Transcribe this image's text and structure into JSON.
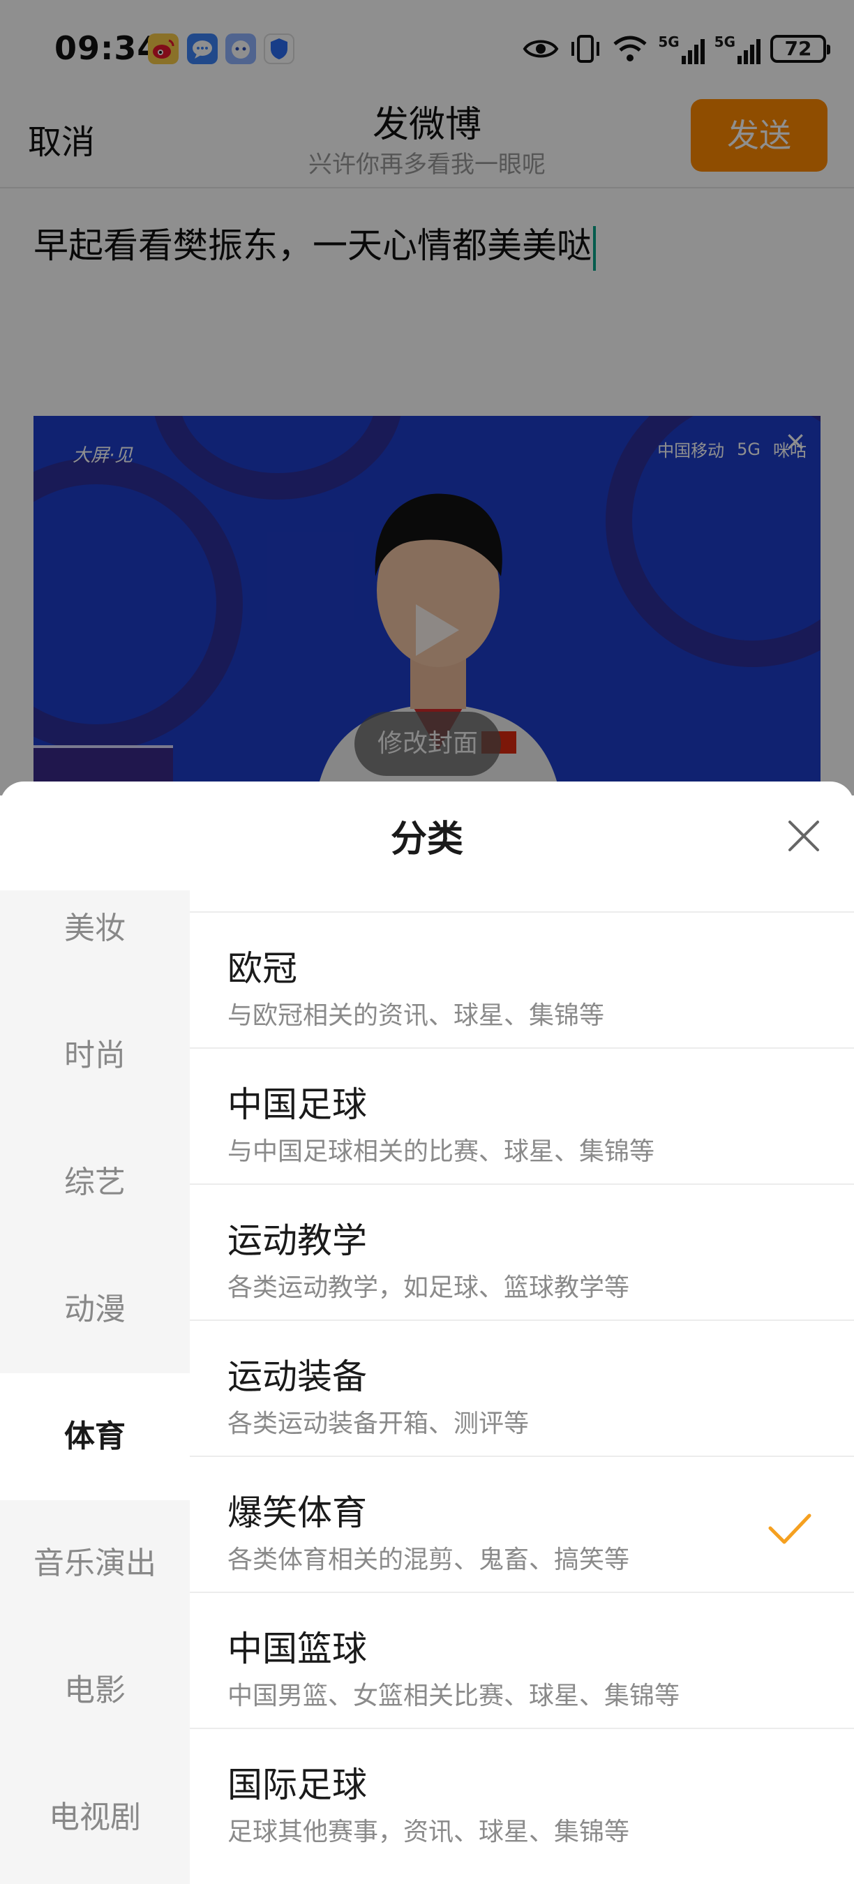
{
  "status_bar": {
    "time": "09:34",
    "app_icons": [
      "weibo-icon",
      "message-icon",
      "chatbot-icon",
      "shield-icon"
    ],
    "network": [
      "5G",
      "5G"
    ],
    "battery": "72"
  },
  "nav": {
    "cancel_label": "取消",
    "title": "发微博",
    "subtitle": "兴许你再多看我一眼呢",
    "send_label": "发送"
  },
  "compose": {
    "text": "早起看看樊振东，一天心情都美美哒"
  },
  "video": {
    "logo_left": "大屏·见",
    "logos_right": [
      "中国移动",
      "5G",
      "咪咕"
    ],
    "cover_button": "修改封面"
  },
  "sheet": {
    "title": "分类",
    "sidebar": [
      {
        "label": "美妆",
        "active": false
      },
      {
        "label": "时尚",
        "active": false
      },
      {
        "label": "综艺",
        "active": false
      },
      {
        "label": "动漫",
        "active": false
      },
      {
        "label": "体育",
        "active": true
      },
      {
        "label": "音乐演出",
        "active": false
      },
      {
        "label": "电影",
        "active": false
      },
      {
        "label": "电视剧",
        "active": false
      }
    ],
    "items": [
      {
        "title": "欧冠",
        "desc": "与欧冠相关的资讯、球星、集锦等",
        "selected": false
      },
      {
        "title": "中国足球",
        "desc": "与中国足球相关的比赛、球星、集锦等",
        "selected": false
      },
      {
        "title": "运动教学",
        "desc": "各类运动教学，如足球、篮球教学等",
        "selected": false
      },
      {
        "title": "运动装备",
        "desc": "各类运动装备开箱、测评等",
        "selected": false
      },
      {
        "title": "爆笑体育",
        "desc": "各类体育相关的混剪、鬼畜、搞笑等",
        "selected": true
      },
      {
        "title": "中国篮球",
        "desc": "中国男篮、女篮相关比赛、球星、集锦等",
        "selected": false
      },
      {
        "title": "国际足球",
        "desc": "足球其他赛事，资讯、球星、集锦等",
        "selected": false
      }
    ]
  },
  "colors": {
    "accent": "#ff8a00",
    "caret": "#0aa58a",
    "check": "#f5a020",
    "video_bg": "#1e3dc9"
  }
}
